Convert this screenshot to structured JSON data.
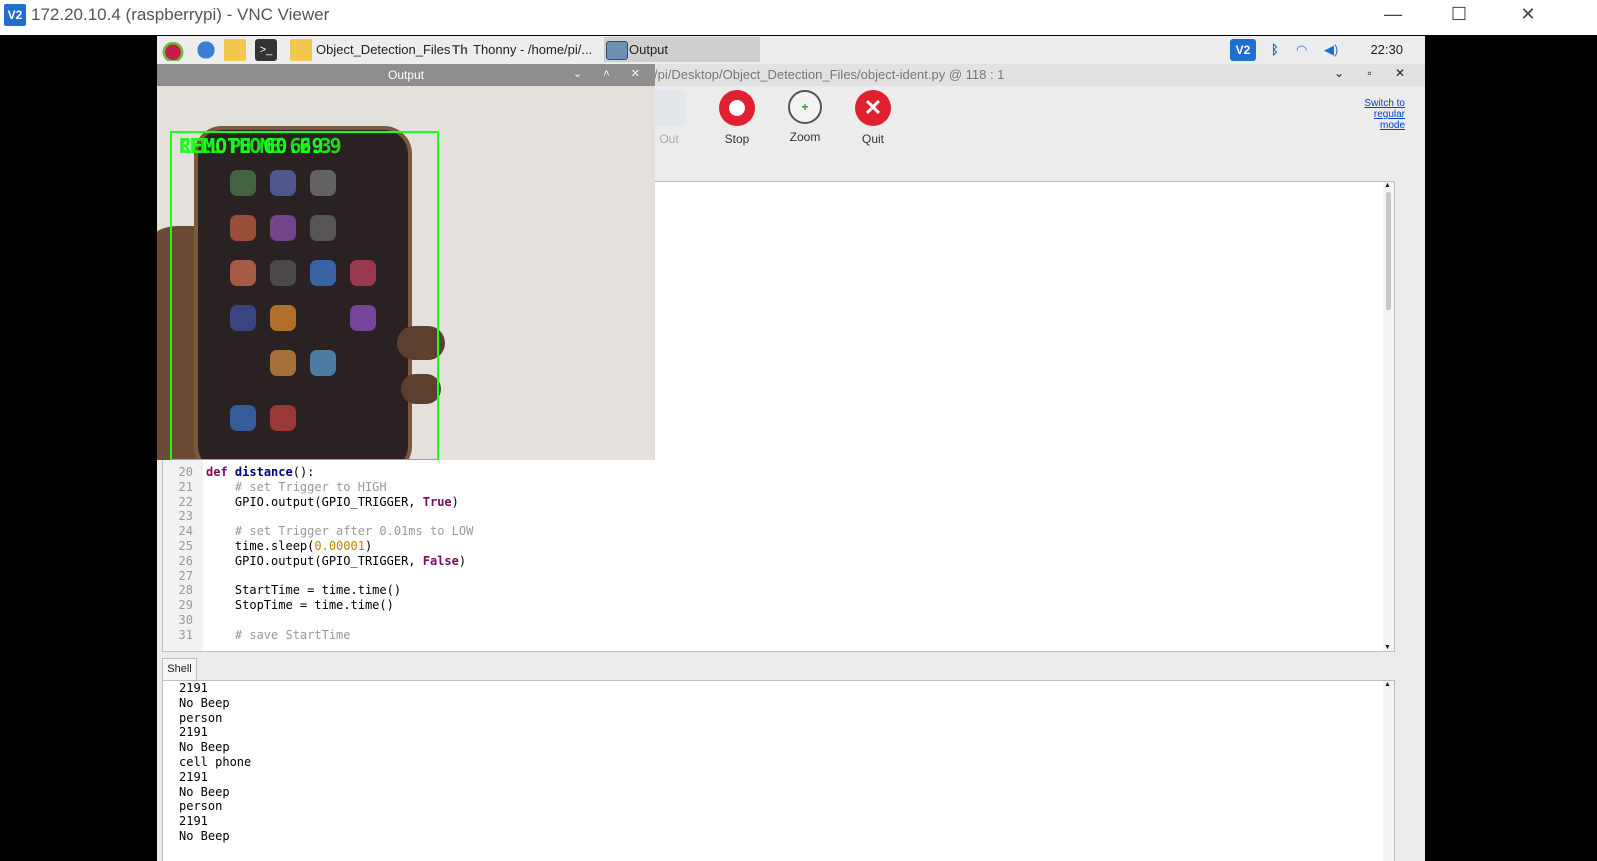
{
  "vnc": {
    "logo": "V2",
    "title": "172.20.10.4 (raspberrypi) - VNC Viewer",
    "minimize": "—",
    "maximize": "☐",
    "close": "✕"
  },
  "panel": {
    "folder_task": "Object_Detection_Files",
    "thonny_task": "Thonny  -  /home/pi/...",
    "output_task": "Output",
    "clock": "22:30"
  },
  "thonny": {
    "title": "/pi/Desktop/Object_Detection_Files/object-ident.py  @  118 : 1",
    "toolbar": {
      "out": "Out",
      "stop": "Stop",
      "zoom": "Zoom",
      "quit": "Quit"
    },
    "switch_link": [
      "Switch to",
      "regular",
      "mode"
    ],
    "code": [
      {
        "n": "20",
        "html": "<span class=\"kw\">def</span> <span class=\"fn\">distance</span>():"
      },
      {
        "n": "21",
        "html": "    <span class=\"cmt\"># set Trigger to HIGH</span>"
      },
      {
        "n": "22",
        "html": "    GPIO.output(GPIO_TRIGGER, <span class=\"kw\">True</span>)"
      },
      {
        "n": "23",
        "html": ""
      },
      {
        "n": "24",
        "html": "    <span class=\"cmt\"># set Trigger after 0.01ms to LOW</span>"
      },
      {
        "n": "25",
        "html": "    time.sleep(<span class=\"num\">0.00001</span>)"
      },
      {
        "n": "26",
        "html": "    GPIO.output(GPIO_TRIGGER, <span class=\"kw\">False</span>)"
      },
      {
        "n": "27",
        "html": ""
      },
      {
        "n": "28",
        "html": "    StartTime = time.time()"
      },
      {
        "n": "29",
        "html": "    StopTime = time.time()"
      },
      {
        "n": "30",
        "html": ""
      },
      {
        "n": "31",
        "html": "    <span class=\"cmt\"># save StartTime</span>"
      }
    ],
    "shell_tab": "Shell",
    "shell": [
      "2191",
      "No Beep",
      "person",
      "2191",
      "No Beep",
      "cell phone",
      "2191",
      "No Beep",
      "person",
      "2191",
      "No Beep"
    ]
  },
  "output_window": {
    "title": "Output",
    "ctrls": "⌄ ˄ ✕",
    "detection_label_a": "REMOTE   60.69",
    "detection_label_b": "CELL PHONE  62.39"
  },
  "colors": {
    "detection_box": "#19ff19",
    "stop_red": "#e0202f",
    "quit_red": "#e0202f",
    "vnc_blue": "#1f6fd1"
  }
}
